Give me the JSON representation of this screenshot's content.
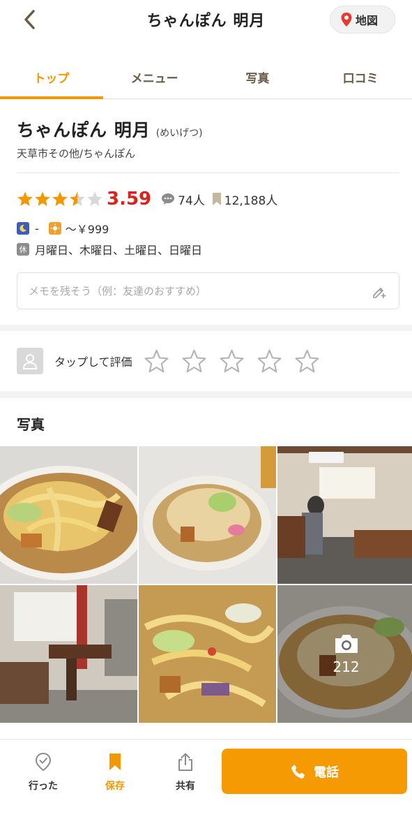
{
  "header": {
    "title": "ちゃんぽん 明月",
    "map_label": "地図"
  },
  "tabs": [
    {
      "label": "トップ",
      "active": true
    },
    {
      "label": "メニュー",
      "active": false
    },
    {
      "label": "写真",
      "active": false
    },
    {
      "label": "口コミ",
      "active": false
    }
  ],
  "shop": {
    "name": "ちゃんぽん 明月",
    "reading": "(めいげつ)",
    "area_genre": "天草市その他/ちゃんぽん",
    "rating": "3.59",
    "rating_stars": 3.5,
    "reviews": "74人",
    "saves": "12,188人",
    "dinner_budget": "-",
    "lunch_budget": "～￥999",
    "closed_label": "休",
    "closed_days": "月曜日、木曜日、土曜日、日曜日",
    "memo_placeholder": "メモを残そう（例：友達のおすすめ）"
  },
  "evaluate": {
    "label": "タップして評価"
  },
  "photos": {
    "title": "写真",
    "more_count": "212"
  },
  "bottom_bar": {
    "went_label": "行った",
    "save_label": "保存",
    "share_label": "共有",
    "call_label": "電話"
  },
  "colors": {
    "accent": "#f39800",
    "score": "#d9241d",
    "call_button": "#f69a03"
  }
}
